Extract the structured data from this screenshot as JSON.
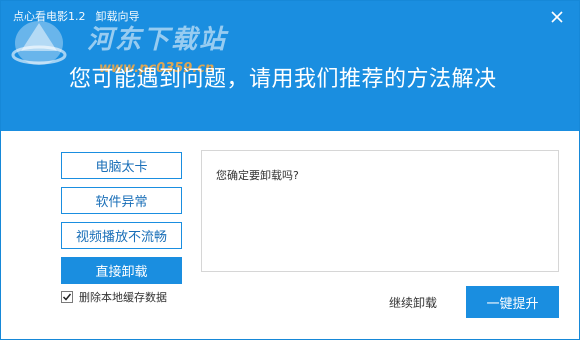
{
  "title_bar": {
    "app_title": "点心看电影1.2",
    "wizard_title": "卸载向导",
    "close_icon": "close-icon"
  },
  "watermark": {
    "site_name": "河东下载站",
    "url": "www.pc0359.cn"
  },
  "headline": "您可能遇到问题，请用我们推荐的方法解决",
  "reasons": [
    {
      "label": "电脑太卡"
    },
    {
      "label": "软件异常"
    },
    {
      "label": "视频播放不流畅"
    },
    {
      "label": "直接卸载",
      "selected": true
    }
  ],
  "message": "您确定要卸载吗?",
  "checkbox": {
    "label": "删除本地缓存数据",
    "checked": true
  },
  "actions": {
    "continue_label": "继续卸载",
    "speedup_label": "一键提升"
  },
  "colors": {
    "accent": "#1a8ee0",
    "text": "#333333"
  }
}
